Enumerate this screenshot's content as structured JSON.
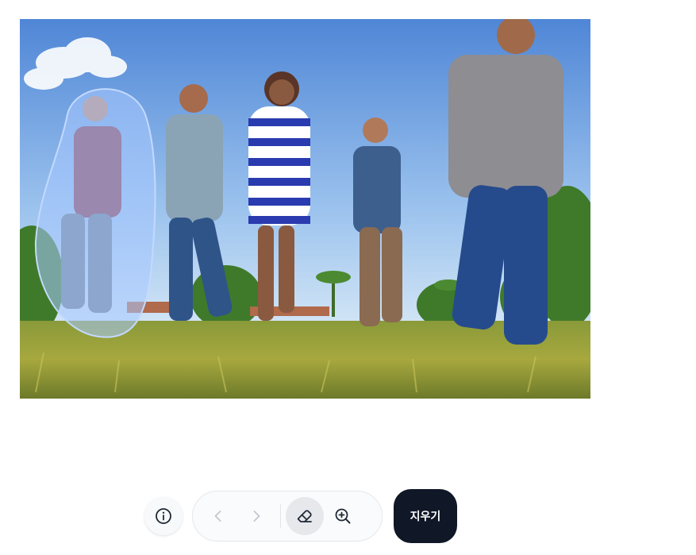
{
  "photo": {
    "subject": "five-people-running-in-grass-field",
    "mask_color": "#a8c8ff"
  },
  "toolbar": {
    "info_icon": "info-circle-icon",
    "undo_icon": "chevron-left-icon",
    "redo_icon": "chevron-right-icon",
    "eraser_icon": "eraser-icon",
    "zoom_icon": "zoom-in-icon",
    "erase_label": "지우기"
  },
  "colors": {
    "primary_button": "#101727",
    "active_tool_bg": "#e6e8ec"
  }
}
